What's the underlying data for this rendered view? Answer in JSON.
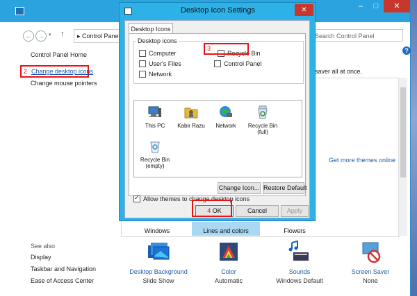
{
  "control_panel": {
    "address": "Control Panel",
    "search_placeholder": "Search Control Panel",
    "left_links": {
      "home": "Control Panel Home",
      "step2_number": "2",
      "change_icons": "Change desktop icons",
      "mouse_pointers": "Change mouse pointers"
    },
    "saver_text": "saver all at once.",
    "more_themes": "Get more themes online",
    "themes": [
      "Windows",
      "Lines and colors",
      "Flowers"
    ],
    "see_also": {
      "heading": "See also",
      "links": [
        "Display",
        "Taskbar and Navigation",
        "Ease of Access Center"
      ]
    },
    "bottom_items": [
      {
        "title": "Desktop Background",
        "sub": "Slide Show"
      },
      {
        "title": "Color",
        "sub": "Automatic"
      },
      {
        "title": "Sounds",
        "sub": "Windows Default"
      },
      {
        "title": "Screen Saver",
        "sub": "None"
      }
    ],
    "help": "?"
  },
  "dialog": {
    "title": "Desktop Icon Settings",
    "close": "✕",
    "tab": "Desktop Icons",
    "group_label": "Desktop icons",
    "checkboxes": {
      "computer": {
        "label": "Computer",
        "checked": false
      },
      "users_files": {
        "label": "User's Files",
        "checked": false
      },
      "network": {
        "label": "Network",
        "checked": false
      },
      "recycle_bin": {
        "label": "Recycle Bin",
        "checked": false
      },
      "control_panel": {
        "label": "Control Panel",
        "checked": false
      }
    },
    "step3_number": "3",
    "icons": [
      {
        "label": "This PC"
      },
      {
        "label": "Kabir Razu"
      },
      {
        "label": "Network"
      },
      {
        "label": "Recycle Bin (full)"
      },
      {
        "label": "Recycle Bin (empty)"
      }
    ],
    "change_icon": "Change Icon...",
    "restore_default": "Restore Default",
    "allow_themes": {
      "label": "Allow themes to change desktop icons",
      "checked": true
    },
    "step4_number": "4",
    "ok": "OK",
    "cancel": "Cancel",
    "apply": "Apply"
  },
  "colors": {
    "accent": "#2aa3df",
    "highlight_red": "#e11111",
    "link_blue": "#1e5fa8"
  }
}
